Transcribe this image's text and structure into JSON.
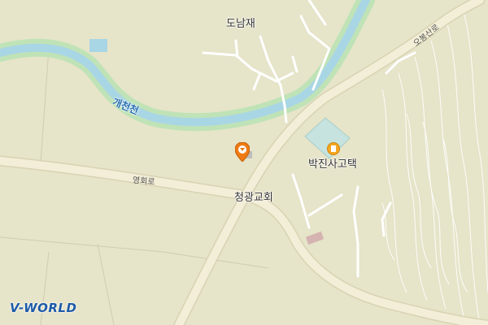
{
  "map": {
    "labels": {
      "donamjae": "도남재",
      "stream": "개천천",
      "school": "박진사고택",
      "church": "청광교회",
      "road_yeonghoe": "영회로",
      "road_obong": "오봉산로"
    },
    "logo": "V-WORLD",
    "colors": {
      "land": "#e6e4c9",
      "river_fill": "#a9d6e5",
      "river_bank": "#bfe3b6",
      "major_road": "#f3eed8",
      "minor_road": "#ffffff",
      "contour": "#ffffff",
      "pin": "#f07a14"
    }
  }
}
